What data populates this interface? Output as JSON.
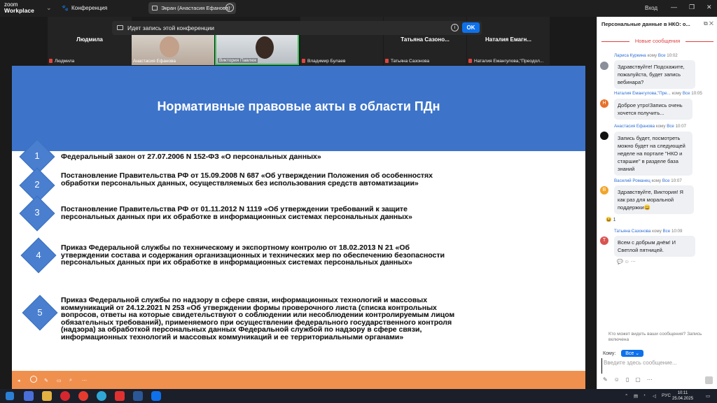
{
  "app": {
    "logo_line1": "zoom",
    "logo_line2": "Workplace",
    "conference_label": "Конференция",
    "screen_label": "Экран (Анастасия Ефанова)",
    "login_label": "Вход"
  },
  "recording": {
    "text": "Идет запись этой конференции",
    "ok_label": "OK"
  },
  "participants": [
    {
      "name": "Людмила",
      "label": "Людмила"
    },
    {
      "name": "",
      "label": "Анастасия Ефанова"
    },
    {
      "name": "Виктория Павлюк",
      "label": "Виктория Павлюк"
    },
    {
      "name": "",
      "label": "Владимир Булаев"
    },
    {
      "name": "Татьяна Сазоно...",
      "label": "Татьяна Сазонова"
    },
    {
      "name": "Наталия Емагн...",
      "label": "Наталия Емангулова,\"Преодол..."
    }
  ],
  "slide": {
    "title": "Нормативные правовые акты в области ПДн",
    "items": [
      {
        "num": "1",
        "lines": [
          "Федеральный закон от 27.07.2006 N 152-ФЗ «О персональных данных»"
        ]
      },
      {
        "num": "2",
        "lines": [
          "Постановление Правительства РФ от 15.09.2008 N 687 «Об утверждении Положения об особенностях",
          "обработки персональных данных, осуществляемых без использования средств автоматизации»"
        ]
      },
      {
        "num": "3",
        "lines": [
          "Постановление Правительства РФ от 01.11.2012 N 1119 «Об утверждении требований к защите",
          "персональных данных при их обработке в информационных системах персональных данных»"
        ]
      },
      {
        "num": "4",
        "lines": [
          "Приказ Федеральной службы по техническому и экспортному контролю от 18.02.2013 N 21  «Об",
          "утверждении состава  и содержания организационных  и технических мер по обеспечению безопасности",
          "персональных данных при их обработке в информационных системах персональных данных»"
        ]
      },
      {
        "num": "5",
        "lines": [
          "Приказ Федеральной службы по надзору в сфере связи, информационных технологий и массовых",
          "коммуникаций от 24.12.2021 N 253  «Об утверждении формы проверочного листа (списка контрольных",
          "вопросов, ответы на которые свидетельствуют  о соблюдении или несоблюдении контролируемым лицом",
          "обязательных требований), применяемого при осуществлении федерального государственного контроля",
          "(надзора) за обработкой персональных данных Федеральной службой по надзору в сфере связи,",
          "информационных технологий и массовых коммуникаций и ее территориальными органами»"
        ]
      }
    ]
  },
  "chat": {
    "title": "Персональные данные в НКО: о...",
    "new_messages": "Новые сообщения",
    "messages": [
      {
        "name": "Лариса Куркина",
        "to_word": "кому",
        "to": "Все",
        "time": "10:02",
        "text": "Здравствуйте! Подскажите, пожалуйста, будет запись вебинара?",
        "avatar": "",
        "avatar_color": "#8a8f99"
      },
      {
        "name": "Наталия Емангулова,\"Пре...",
        "to_word": "кому",
        "to": "Все",
        "time": "10:05",
        "text": "Доброе утро!Запись очень хочется получить...",
        "avatar": "Н",
        "avatar_color": "#e8702a"
      },
      {
        "name": "Анастасия Ефанова",
        "to_word": "кому",
        "to": "Все",
        "time": "10:07",
        "text": "Запись будет, посмотреть можно будет на следующей неделе на портале \"НКО и старшие\" в разделе база знаний",
        "avatar": "",
        "avatar_color": "#111"
      },
      {
        "name": "Василий Романец",
        "to_word": "кому",
        "to": "Все",
        "time": "10:07",
        "text": "Здравствуйте, Виктория! Я как раз для моральной поддержки😀",
        "avatar": "В",
        "avatar_color": "#f2a52a"
      },
      {
        "name": "Татьяна Сазонова",
        "to_word": "кому",
        "to": "Все",
        "time": "10:09",
        "text": "Всем с добрым днём! И Светлой пятницей.",
        "avatar": "Т",
        "avatar_color": "#d9534f"
      }
    ],
    "reaction": "😆 1",
    "who_can_see": "Кто может видеть ваши сообщения? Запись включена",
    "to_label": "Кому:",
    "to_value": "Все",
    "input_placeholder": "Введите здесь сообщение..."
  },
  "taskbar": {
    "lang": "РУС",
    "time": "10:11",
    "date": "25.04.2025"
  }
}
